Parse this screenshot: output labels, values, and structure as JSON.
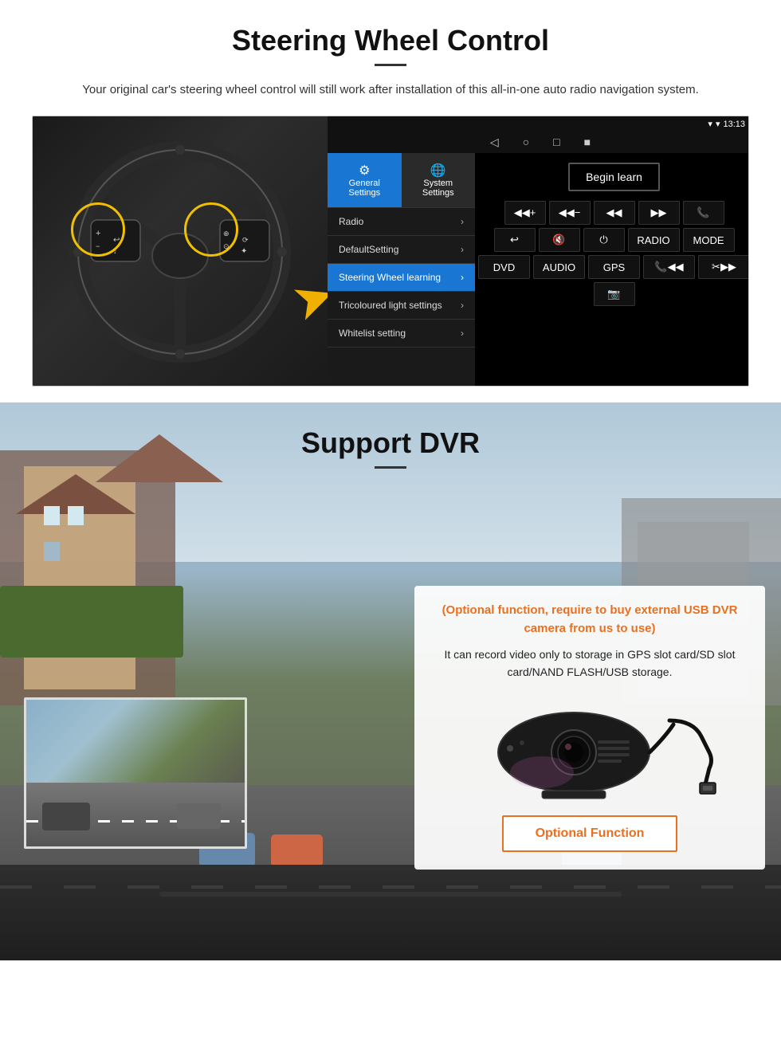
{
  "steering": {
    "title": "Steering Wheel Control",
    "description": "Your original car's steering wheel control will still work after installation of this all-in-one auto radio navigation system.",
    "statusbar": {
      "time": "13:13",
      "signal_icon": "▼",
      "wifi_icon": "▾"
    },
    "nav_buttons": [
      "◁",
      "○",
      "□",
      "■"
    ],
    "tabs": [
      {
        "label": "General Settings",
        "icon": "⚙",
        "active": true
      },
      {
        "label": "System Settings",
        "icon": "🌐",
        "active": false
      }
    ],
    "menu_items": [
      {
        "label": "Radio",
        "active": false
      },
      {
        "label": "DefaultSetting",
        "active": false
      },
      {
        "label": "Steering Wheel learning",
        "active": true
      },
      {
        "label": "Tricoloured light settings",
        "active": false
      },
      {
        "label": "Whitelist setting",
        "active": false
      }
    ],
    "begin_learn": "Begin learn",
    "control_buttons_row1": [
      "◀◀+",
      "◀◀—",
      "◀◀",
      "▶▶",
      "📞"
    ],
    "control_buttons_row2": [
      "↩",
      "🔇",
      "⏻",
      "RADIO",
      "MODE"
    ],
    "control_buttons_row3": [
      "DVD",
      "AUDIO",
      "GPS",
      "📞◀◀",
      "✂▶▶"
    ],
    "control_buttons_row4": [
      "📷"
    ]
  },
  "dvr": {
    "title": "Support DVR",
    "optional_text": "(Optional function, require to buy external USB DVR camera from us to use)",
    "body_text": "It can record video only to storage in GPS slot card/SD slot card/NAND FLASH/USB storage.",
    "optional_function_label": "Optional Function"
  }
}
